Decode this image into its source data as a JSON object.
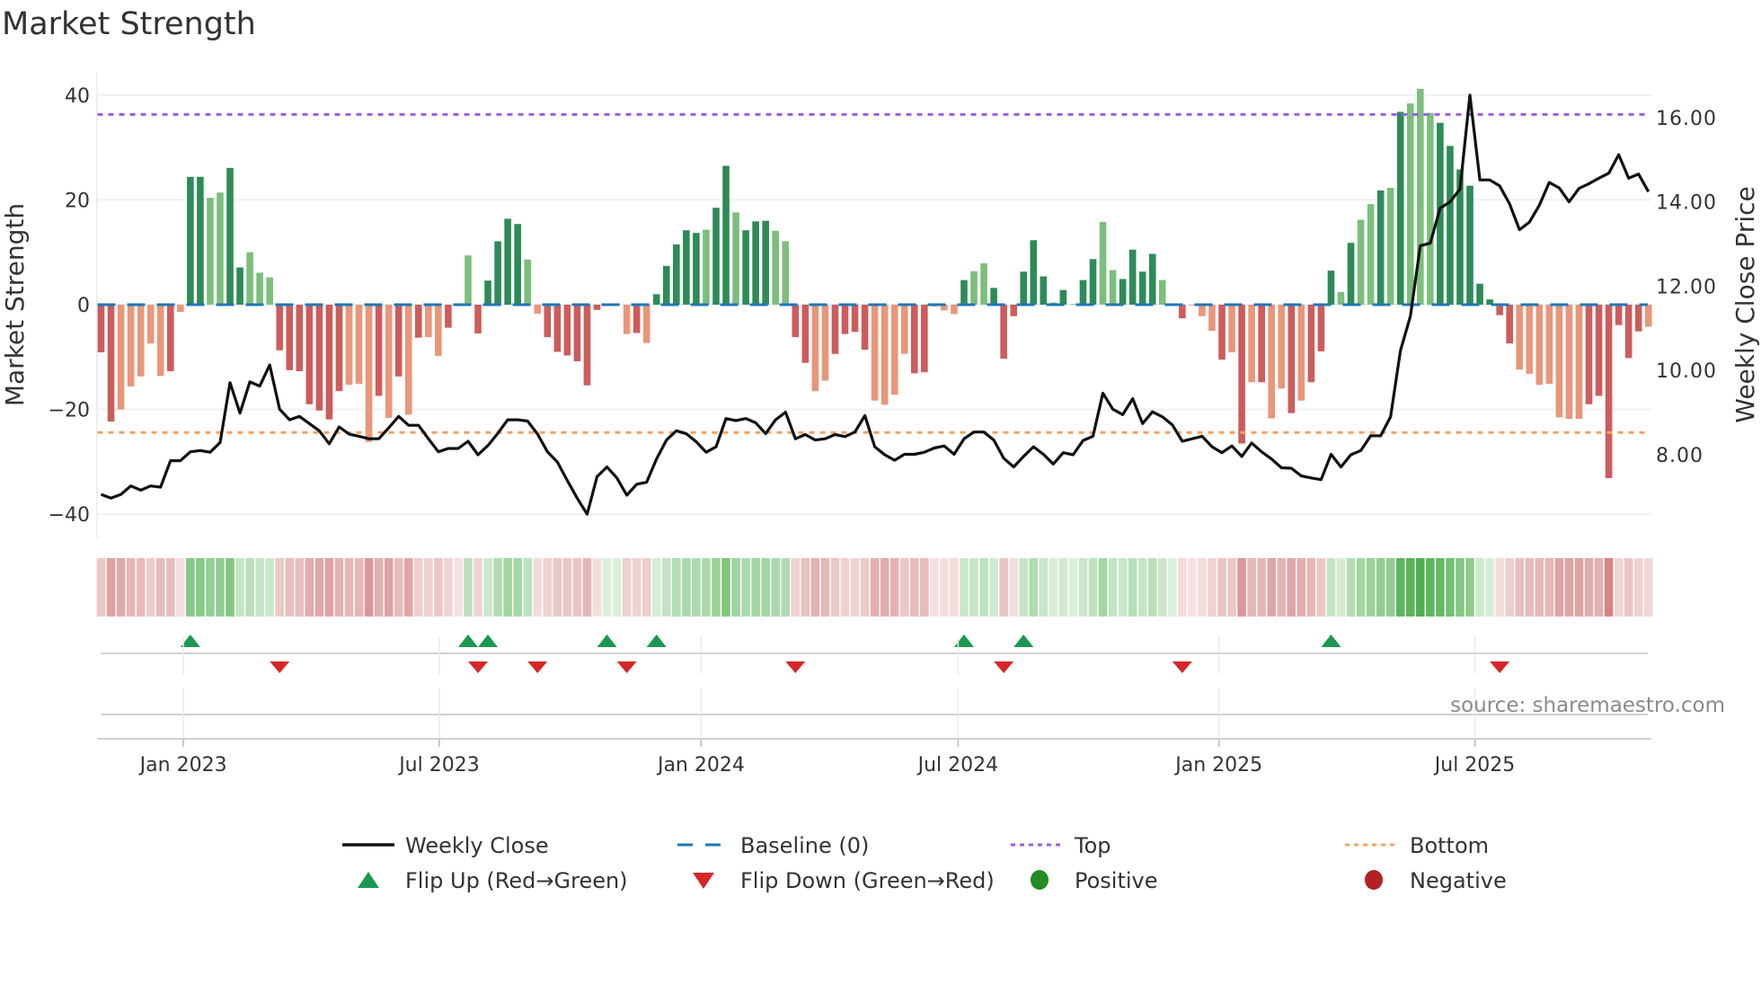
{
  "chart_data": {
    "type": "bar+line",
    "title": "Market Strength",
    "ylabel": "Market Strength",
    "y2label": "Weekly Close Price",
    "ylim": [
      -44,
      44
    ],
    "y2lim": [
      6.2,
      17.2
    ],
    "yticks": [
      "40",
      "20",
      "0",
      "−20",
      "−40"
    ],
    "ytick_values": [
      40,
      20,
      0,
      -20,
      -40
    ],
    "y2ticks": [
      "16.00",
      "14.00",
      "12.00",
      "10.00",
      "8.00"
    ],
    "y2tick_values": [
      16,
      14,
      12,
      10,
      8
    ],
    "xticks": [
      {
        "label": "Jan 2023",
        "week": 8.3
      },
      {
        "label": "Jul 2023",
        "week": 34.1
      },
      {
        "label": "Jan 2024",
        "week": 60.5
      },
      {
        "label": "Jul 2024",
        "week": 86.4
      },
      {
        "label": "Jan 2025",
        "week": 112.7
      },
      {
        "label": "Jul 2025",
        "week": 138.5
      }
    ],
    "top_level": 36.3,
    "bottom_level": -24.4,
    "baseline": 0,
    "strength": [
      -9.1,
      -22.3,
      -20,
      -15.6,
      -13.7,
      -7.4,
      -13.6,
      -12.7,
      -1.4,
      24.4,
      24.4,
      20.4,
      21.4,
      26.1,
      7.1,
      10,
      6.1,
      5.2,
      -8.7,
      -12.5,
      -12.7,
      -19,
      -20.2,
      -21.9,
      -16.5,
      -15.3,
      -15.1,
      -26.2,
      -17.4,
      -21.6,
      -13.7,
      -21,
      -6.3,
      -6.2,
      -9.8,
      -4.4,
      -0.3,
      9.4,
      -5.5,
      4.6,
      12.1,
      16.4,
      15.4,
      8.6,
      -1.7,
      -6.2,
      -9,
      -9.7,
      -10.8,
      -15.4,
      -1,
      0.2,
      0.1,
      -5.6,
      -5.4,
      -7.3,
      2,
      7.4,
      11.5,
      14.2,
      13.7,
      14.3,
      18.5,
      26.5,
      17.6,
      14.2,
      15.9,
      16,
      14.1,
      12.1,
      -6.2,
      -11.1,
      -16.5,
      -14.5,
      -9.4,
      -5.6,
      -5.2,
      -8.6,
      -18.3,
      -19.1,
      -17.2,
      -9.4,
      -13.1,
      -12.9,
      -0.3,
      -1.1,
      -1.8,
      4.7,
      6.4,
      7.9,
      3.2,
      -10.3,
      -2.2,
      6.3,
      12.3,
      5.4,
      0.4,
      2.8,
      0.1,
      4.7,
      8.7,
      15.8,
      6.6,
      4.9,
      10.5,
      6.3,
      9.7,
      4.7,
      0.1,
      -2.6,
      -0.1,
      -2.2,
      -5,
      -10.5,
      -9.1,
      -26.5,
      -14.8,
      -14.8,
      -21.7,
      -16,
      -20.7,
      -18.3,
      -14.8,
      -8.9,
      6.5,
      2.4,
      11.8,
      16.2,
      19.2,
      21.8,
      22.3,
      36.8,
      38.4,
      41.2,
      36.6,
      34.7,
      30.3,
      25.8,
      22.7,
      4,
      1,
      -2,
      -7.4,
      -12.4,
      -13.2,
      -15.3,
      -15.1,
      -21.5,
      -21.8,
      -21.8,
      -19,
      -17.4,
      -33.1,
      -3.9,
      -10.2,
      -5.1,
      -4.2
    ],
    "shade": "ddllllldlddllddllldddddddllldldldlldlldddddllddddddllldldddddlddldddllddllddddlllldddlldllddddddldlddllddddlddllldldldlldldddldlldldlllddddddddlllllllddddddlddllldldll",
    "weekly_close": [
      7.06,
      6.97,
      7.06,
      7.26,
      7.16,
      7.26,
      7.23,
      7.86,
      7.86,
      8.07,
      8.1,
      8.06,
      8.29,
      9.71,
      8.99,
      9.73,
      9.63,
      10.13,
      9.08,
      8.83,
      8.91,
      8.74,
      8.57,
      8.26,
      8.66,
      8.49,
      8.44,
      8.38,
      8.38,
      8.64,
      8.91,
      8.7,
      8.7,
      8.38,
      8.07,
      8.15,
      8.15,
      8.32,
      8.0,
      8.22,
      8.51,
      8.83,
      8.83,
      8.8,
      8.49,
      8.07,
      7.83,
      7.39,
      6.97,
      6.59,
      7.48,
      7.71,
      7.45,
      7.04,
      7.3,
      7.35,
      7.9,
      8.35,
      8.57,
      8.5,
      8.31,
      8.06,
      8.19,
      8.86,
      8.81,
      8.86,
      8.76,
      8.5,
      8.83,
      9.01,
      8.38,
      8.48,
      8.35,
      8.38,
      8.48,
      8.43,
      8.54,
      8.93,
      8.19,
      8.0,
      7.87,
      8.01,
      8.01,
      8.06,
      8.16,
      8.21,
      8.01,
      8.38,
      8.54,
      8.54,
      8.35,
      7.92,
      7.71,
      7.96,
      8.19,
      8.01,
      7.78,
      8.05,
      8.0,
      8.34,
      8.44,
      9.46,
      9.08,
      8.95,
      9.33,
      8.74,
      9.02,
      8.9,
      8.71,
      8.32,
      8.38,
      8.44,
      8.19,
      8.05,
      8.21,
      7.96,
      8.28,
      8.07,
      7.9,
      7.69,
      7.68,
      7.5,
      7.45,
      7.41,
      8.01,
      7.71,
      8.0,
      8.1,
      8.45,
      8.45,
      8.9,
      10.47,
      11.29,
      12.96,
      13.02,
      13.85,
      14.0,
      14.3,
      16.53,
      14.52,
      14.52,
      14.38,
      13.95,
      13.34,
      13.52,
      13.92,
      14.46,
      14.33,
      14.0,
      14.32,
      14.43,
      14.56,
      14.68,
      15.12,
      14.56,
      14.66,
      14.24
    ],
    "flip_up_weeks": [
      9,
      37,
      39,
      51,
      56,
      87,
      93,
      124
    ],
    "flip_down_weeks": [
      18,
      38,
      44,
      53,
      70,
      91,
      109,
      141
    ],
    "legend": {
      "placement": "bottom",
      "items": [
        {
          "label": "Weekly Close",
          "kind": "line",
          "color": "#111111"
        },
        {
          "label": "Baseline (0)",
          "kind": "dash",
          "color": "#1f77b4"
        },
        {
          "label": "Top",
          "kind": "dot",
          "color": "#9b5de5"
        },
        {
          "label": "Bottom",
          "kind": "dot",
          "color": "#f4a261"
        },
        {
          "label": "Flip Up (Red→Green)",
          "kind": "up",
          "color": "#1a9850"
        },
        {
          "label": "Flip Down (Green→Red)",
          "kind": "down",
          "color": "#d62728"
        },
        {
          "label": "Positive",
          "kind": "circle",
          "color": "#228b22"
        },
        {
          "label": "Negative",
          "kind": "circle",
          "color": "#b22222"
        }
      ]
    },
    "colors": {
      "pos_dark": "#2e8b57",
      "pos_light": "#7cbf7c",
      "neg_dark": "#cd5c5c",
      "neg_light": "#e9967a",
      "top": "#9b5de5",
      "bottom": "#f4a261",
      "baseline": "#1f77b4",
      "price": "#111111",
      "up": "#1a9850",
      "down": "#d62728"
    },
    "source": "source: sharemaestro.com"
  }
}
